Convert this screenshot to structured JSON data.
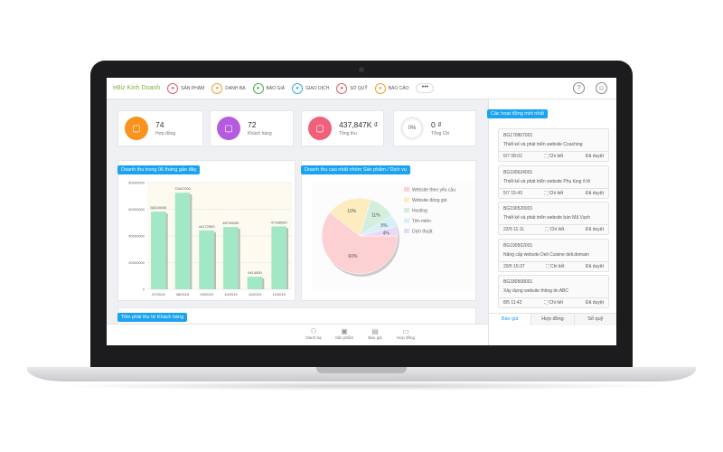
{
  "header": {
    "brand": "eBiz Kinh Doanh",
    "nav": [
      {
        "label": "SẢN PHẨM",
        "icon": "box-icon",
        "color": "#e35d6a"
      },
      {
        "label": "DANH BẠ",
        "icon": "contacts-icon",
        "color": "#f0a030"
      },
      {
        "label": "BÁO GIÁ",
        "icon": "quote-icon",
        "color": "#4caf50"
      },
      {
        "label": "GIAO DỊCH",
        "icon": "link-icon",
        "color": "#3aaee0"
      },
      {
        "label": "SỔ QUỸ",
        "icon": "wallet-icon",
        "color": "#e35d6a"
      },
      {
        "label": "BÁO CÁO",
        "icon": "chart-icon",
        "color": "#f0a030"
      }
    ],
    "more": "•••",
    "help": "?",
    "user": "user-icon"
  },
  "stats": [
    {
      "value": "74",
      "label": "Hợp đồng",
      "color": "#f7931e",
      "icon": "folder-icon"
    },
    {
      "value": "72",
      "label": "Khách hàng",
      "color": "#b45be0",
      "icon": "users-icon"
    },
    {
      "value": "437,847K ₫",
      "label": "Tổng thu",
      "color": "#f0607a",
      "icon": "globe-icon"
    },
    {
      "value": "0 ₫",
      "label": "Tổng Chi",
      "ring": "0%",
      "progress": 0
    }
  ],
  "chart_data": [
    {
      "type": "bar",
      "title": "Doanh thu trong 06 tháng gần đây",
      "categories": [
        "07/2019",
        "08/2019",
        "09/2019",
        "10/2019",
        "11/2019",
        "12/2019"
      ],
      "values": [
        58216000,
        72447000,
        44172500,
        46745000,
        9414500,
        47188000
      ],
      "ylim": [
        0,
        80000000
      ],
      "yticks": [
        "0",
        "20000000",
        "40000000",
        "60000000",
        "80000000"
      ],
      "color": "#a3e8c6",
      "grid": true
    },
    {
      "type": "pie",
      "title": "Doanh thu cao nhất nhóm Sản phẩm / Dịch vụ",
      "legend_position": "right",
      "slices": [
        {
          "name": "Website theo yêu cầu",
          "value": 60,
          "label": "60%",
          "color": "#fdd0d4"
        },
        {
          "name": "Website đóng gói",
          "value": 19,
          "label": "19%",
          "color": "#fcecbf"
        },
        {
          "name": "Hosting",
          "value": 11,
          "label": "11%",
          "color": "#d3eedd"
        },
        {
          "name": "Tên miền",
          "value": 5,
          "label": "5%",
          "color": "#d6f0f8"
        },
        {
          "name": "Dịch thuật",
          "value": 4,
          "label": "4%",
          "color": "#ead8f8"
        }
      ]
    }
  ],
  "receivables_title": "Tiền phải thu từ Khách hàng",
  "activity": {
    "title": "Các hoạt động mới nhất",
    "detail": "Chi tiết",
    "items": [
      {
        "code": "BG170807001",
        "desc": "Thiết kế và phát triển website Coaching",
        "time": "6/7 08:02",
        "status": "Đã duyệt"
      },
      {
        "code": "BG190624001",
        "desc": "Thiết kế và phát triển website Phụ tùng ô tô",
        "time": "5/7 15:43",
        "status": "Đã duyệt"
      },
      {
        "code": "BG190520001",
        "desc": "Thiết kế và phát triển website bán Mã Vạch",
        "time": "22/5 11:11",
        "status": "Đã duyệt"
      },
      {
        "code": "BG190502001",
        "desc": "Nâng cấp website Deli Cuisine deli.domain",
        "time": "20/5 15:37",
        "status": "Đã duyệt"
      },
      {
        "code": "BG180508001",
        "desc": "Xây dựng website thông tin ABC",
        "time": "8/5 11:42",
        "status": "Đã duyệt"
      }
    ],
    "tabs": [
      "Báo giá",
      "Hợp đồng",
      "Sổ quỹ"
    ],
    "active_tab": "Báo giá",
    "accent": "#1aa3f0"
  },
  "bottom_nav": [
    {
      "label": "Danh bạ",
      "glyph": "⚇",
      "icon": "contacts-icon"
    },
    {
      "label": "Sản phẩm",
      "glyph": "▣",
      "icon": "box-icon"
    },
    {
      "label": "Báo giá",
      "glyph": "▤",
      "icon": "quote-icon"
    },
    {
      "label": "Hợp đồng",
      "glyph": "▭",
      "icon": "folder-icon"
    }
  ]
}
